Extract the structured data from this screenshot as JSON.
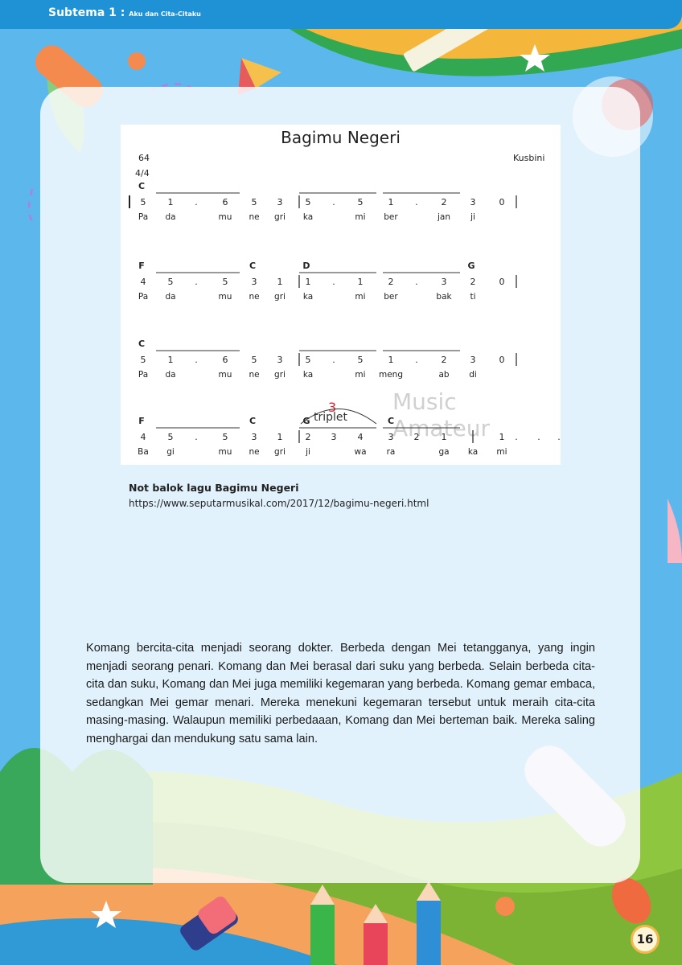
{
  "header": {
    "subtheme": "Subtema 1 :",
    "subtheme_title": "Aku dan Cita-Citaku"
  },
  "score": {
    "title": "Bagimu Negeri",
    "number": "64",
    "time_signature": "4/4",
    "composer": "Kusbini",
    "watermark": "Music Amateur",
    "triplet_number": "3",
    "triplet_label": "triplet",
    "rows": [
      {
        "chords": [
          "C",
          "",
          "",
          "",
          "",
          "",
          "",
          "",
          "",
          "",
          "",
          "",
          ""
        ],
        "notes": [
          "5",
          "1",
          ".",
          "6",
          "5",
          "3",
          "|",
          "5",
          ".",
          "5",
          "1",
          ".",
          "2",
          "3",
          "0",
          "|"
        ],
        "lyrics": [
          "Pa",
          "da",
          "mu",
          "ne",
          "gri",
          "ka",
          "mi",
          "ber",
          "jan",
          "ji"
        ]
      },
      {
        "chords": [
          "F",
          "C",
          "D",
          "G"
        ],
        "notes": [
          "4",
          "5",
          ".",
          "5",
          "3",
          "1",
          "|",
          "1",
          ".",
          "1",
          "2",
          ".",
          "3",
          "2",
          "0",
          "|"
        ],
        "lyrics": [
          "Pa",
          "da",
          "mu",
          "ne",
          "gri",
          "ka",
          "mi",
          "ber",
          "bak",
          "ti"
        ]
      },
      {
        "chords": [
          "C"
        ],
        "notes": [
          "5",
          "1",
          ".",
          "6",
          "5",
          "3",
          "|",
          "5",
          ".",
          "5",
          "1",
          ".",
          "2",
          "3",
          "0",
          "|"
        ],
        "lyrics": [
          "Pa",
          "da",
          "mu",
          "ne",
          "gri",
          "ka",
          "mi",
          "meng",
          "ab",
          "di"
        ]
      },
      {
        "chords": [
          "F",
          "C",
          "G",
          "C"
        ],
        "notes": [
          "4",
          "5",
          ".",
          "5",
          "3",
          "1",
          "|",
          "2",
          "3",
          "4",
          "3",
          "2",
          "1",
          "|",
          "1",
          ".",
          ".",
          "."
        ],
        "lyrics": [
          "Ba",
          "gi",
          "mu",
          "ne",
          "gri",
          "ji",
          "wa",
          "ra",
          "ga",
          "ka",
          "mi"
        ]
      }
    ]
  },
  "caption": {
    "title": "Not balok lagu Bagimu Negeri",
    "link": "https://www.seputarmusikal.com/2017/12/bagimu-negeri.html"
  },
  "paragraph": "Komang bercita-cita menjadi seorang dokter. Berbeda dengan Mei tetangganya, yang ingin menjadi seorang penari. Komang dan Mei berasal dari suku yang berbeda. Selain berbeda cita-cita dan suku, Komang dan Mei juga memiliki kegemaran yang berbeda. Komang gemar embaca, sedangkan Mei gemar menari. Mereka menekuni kegemaran tersebut untuk meraih cita-cita masing-masing. Walaupun memiliki perbedaaan, Komang dan Mei berteman baik. Mereka saling menghargai dan mendukung satu sama lain.",
  "page_number": "16",
  "colors": {
    "header": "#1e92d4",
    "sky": "#5cb8ec",
    "grass": "#8fc63f",
    "path": "#f5a35c"
  }
}
